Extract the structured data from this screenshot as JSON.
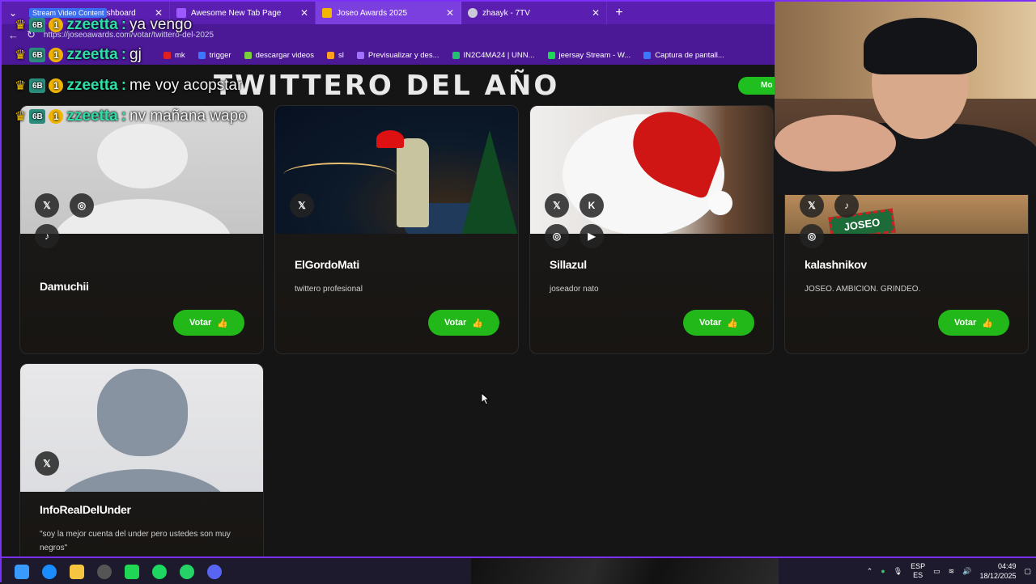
{
  "browser": {
    "media_badge": "Stream Video Content",
    "tabs": [
      {
        "title": "Stream - Kick Dashboard",
        "fav": "green"
      },
      {
        "title": "Awesome New Tab Page",
        "fav": "purple"
      },
      {
        "title": "Joseo Awards 2025",
        "fav": "gold",
        "active": true
      },
      {
        "title": "zhaayk - 7TV",
        "fav": "gray"
      }
    ],
    "url": "https://joseoawards.com/votar/twittero-del-2025",
    "bookmarks": [
      "mk",
      "trigger",
      "descargar videos",
      "sl",
      "Previsualizar y des...",
      "IN2C4MA24 | UNN...",
      "jeersay Stream - W...",
      "Captura de pantall..."
    ]
  },
  "page": {
    "title": "TWITTERO DEL AÑO",
    "more_label": "Mo",
    "vote_label": "Votar",
    "candidates": [
      {
        "name": "Damuchii",
        "bio": "",
        "socials": [
          "x-icon",
          "instagram-icon",
          "tiktok-icon"
        ]
      },
      {
        "name": "ElGordoMati",
        "bio": "twittero profesional",
        "socials": [
          "x-icon"
        ]
      },
      {
        "name": "Sillazul",
        "bio": "joseador nato",
        "socials": [
          "x-icon",
          "kick-icon",
          "instagram-icon",
          "youtube-icon"
        ]
      },
      {
        "name": "kalashnikov",
        "bio": "JOSEO. AMBICION. GRINDEO.",
        "socials": [
          "x-icon",
          "tiktok-icon",
          "instagram-icon"
        ]
      },
      {
        "name": "InfoRealDelUnder",
        "bio": "\"soy la mejor cuenta del under pero ustedes son muy negros\"",
        "socials": [
          "x-icon"
        ]
      }
    ],
    "image_sign": "JOSEO"
  },
  "chat": [
    {
      "user": "zzeetta",
      "msg": "ya vengo"
    },
    {
      "user": "zzeetta",
      "msg": "gj"
    },
    {
      "user": "zzeetta",
      "msg": "me voy acopstar"
    },
    {
      "user": "zzeetta",
      "msg": "nv mañana wapo"
    }
  ],
  "chat_badges": {
    "sub": "6B",
    "tier": "1"
  },
  "taskbar": {
    "lang_top": "ESP",
    "lang_bottom": "ES",
    "time": "04:49",
    "date": "18/12/2025"
  },
  "colors": {
    "accent": "#7b2ff7",
    "vote_green": "#22b81a",
    "chat_user": "#2ee0a8"
  }
}
